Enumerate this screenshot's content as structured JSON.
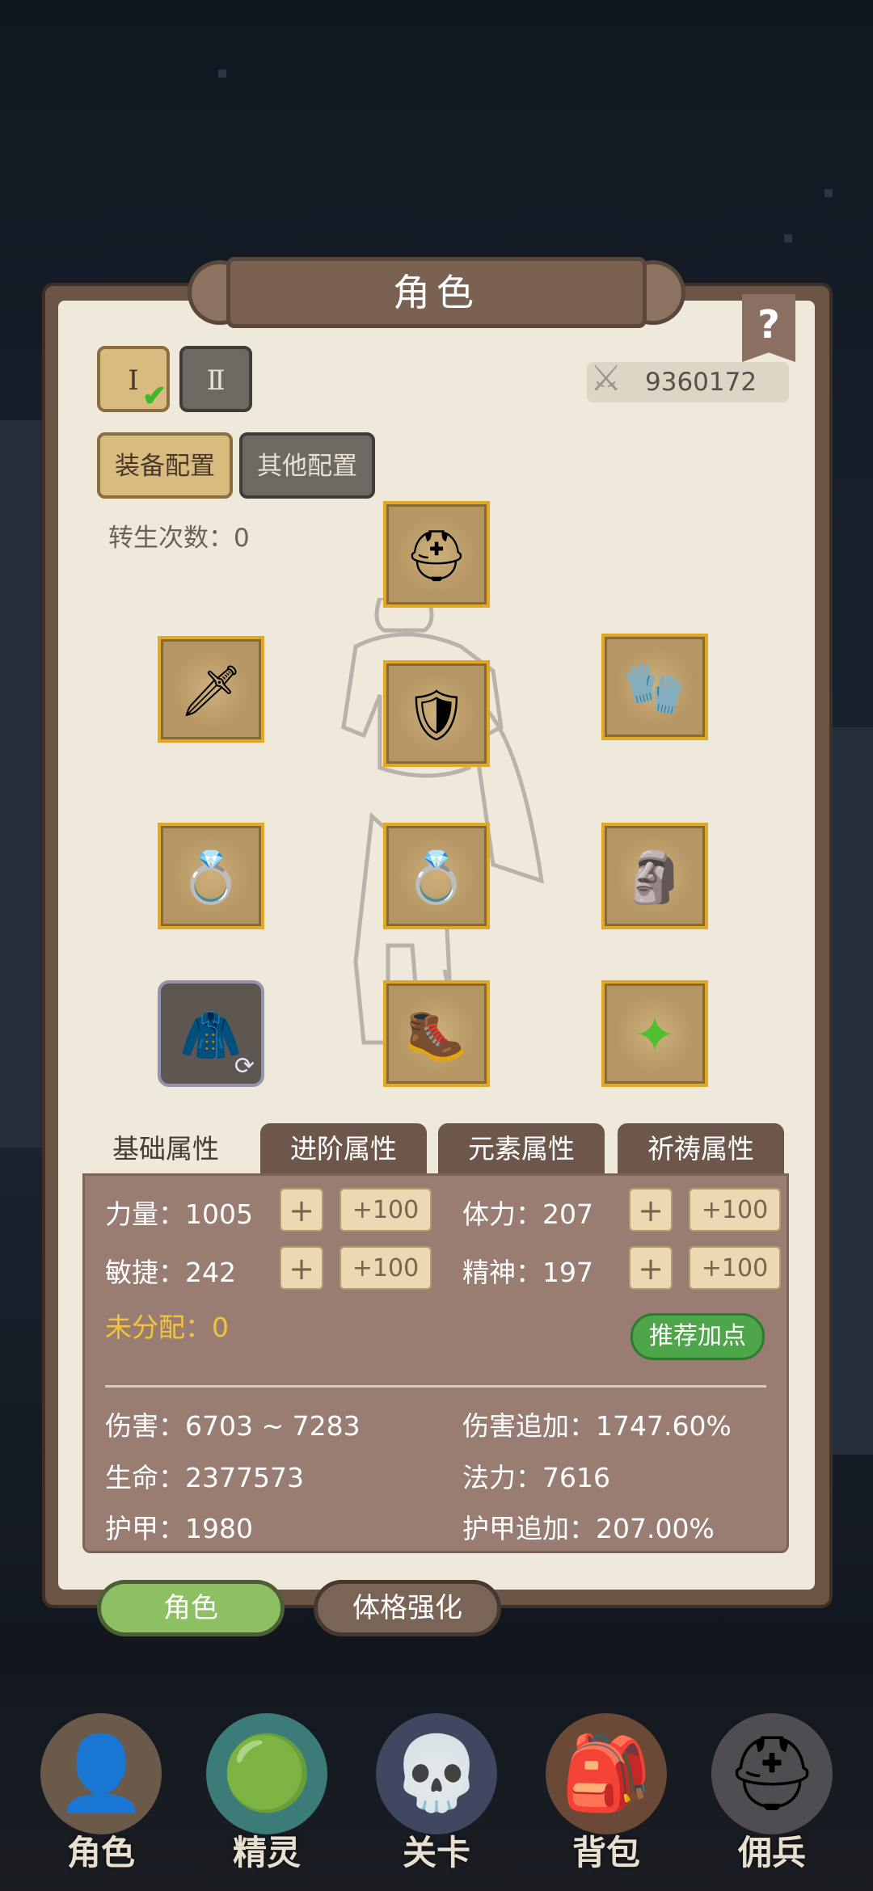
{
  "header": {
    "title": "角色",
    "help_label": "?"
  },
  "config": {
    "set_tabs": [
      {
        "label": "Ⅰ",
        "selected": true
      },
      {
        "label": "Ⅱ",
        "selected": false
      }
    ],
    "power": "9360172",
    "equip_config": "装备配置",
    "other_config": "其他配置",
    "rebirth_label": "转生次数：0"
  },
  "equipment": [
    {
      "slot": "helmet",
      "icon": "⛑"
    },
    {
      "slot": "weapon",
      "icon": "🗡"
    },
    {
      "slot": "armor",
      "icon": "🛡"
    },
    {
      "slot": "gauntlet",
      "icon": "🧤"
    },
    {
      "slot": "bracelet",
      "icon": "💍"
    },
    {
      "slot": "ring",
      "icon": "💍"
    },
    {
      "slot": "pauldron",
      "icon": "🗿"
    },
    {
      "slot": "cloak",
      "icon": "🧥"
    },
    {
      "slot": "boots",
      "icon": "🥾"
    },
    {
      "slot": "gem",
      "icon": "✦"
    }
  ],
  "stat_tabs": [
    "基础属性",
    "进阶属性",
    "元素属性",
    "祈祷属性"
  ],
  "base_stats": {
    "strength": "力量：1005",
    "stamina": "体力：207",
    "agility": "敏捷：242",
    "spirit": "精神：197",
    "plus": "+",
    "plus100": "+100",
    "unallocated": "未分配：0",
    "recommend": "推荐加点"
  },
  "derived": {
    "damage": "伤害：6703 ~ 7283",
    "damage_bonus": "伤害追加：1747.60%",
    "hp": "生命：2377573",
    "mp": "法力：7616",
    "armor": "护甲：1980",
    "armor_bonus": "护甲追加：207.00%"
  },
  "sub_tabs": [
    "角色",
    "体格强化"
  ],
  "nav": [
    {
      "label": "角色",
      "icon": "👤"
    },
    {
      "label": "精灵",
      "icon": "🟢"
    },
    {
      "label": "关卡",
      "icon": "💀"
    },
    {
      "label": "背包",
      "icon": "🎒"
    },
    {
      "label": "佣兵",
      "icon": "⛑"
    }
  ]
}
